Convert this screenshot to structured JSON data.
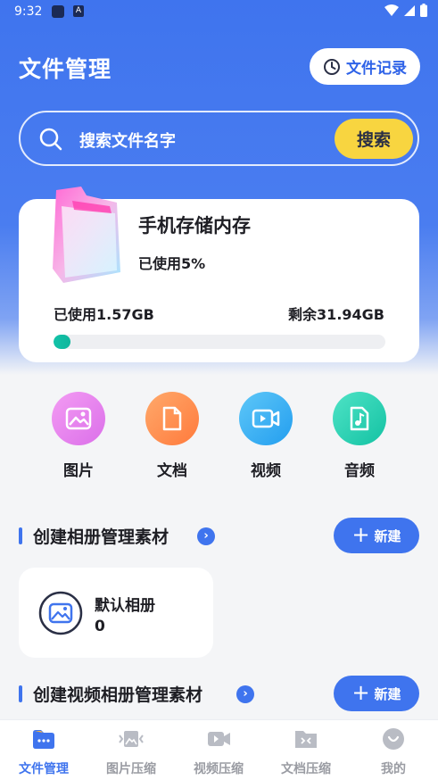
{
  "status_bar": {
    "time": "9:32"
  },
  "header": {
    "title": "文件管理",
    "record_button": "文件记录"
  },
  "search": {
    "placeholder": "搜索文件名字",
    "button": "搜索"
  },
  "storage": {
    "title": "手机存储内存",
    "used_percent_text": "已使用5%",
    "used_text": "已使用1.57GB",
    "free_text": "剩余31.94GB",
    "used_fraction": 0.05
  },
  "categories": [
    {
      "label": "图片",
      "icon": "image-icon",
      "color": "#e98bf0"
    },
    {
      "label": "文档",
      "icon": "document-icon",
      "color": "#ff8f52"
    },
    {
      "label": "视频",
      "icon": "video-icon",
      "color": "#3ab0f4"
    },
    {
      "label": "音频",
      "icon": "music-icon",
      "color": "#2ad3b7"
    }
  ],
  "sections": {
    "album": {
      "title": "创建相册管理素材",
      "new_button": "新建"
    },
    "video_album": {
      "title": "创建视频相册管理素材",
      "new_button": "新建"
    }
  },
  "album_card": {
    "name": "默认相册",
    "count": "0"
  },
  "bottom_nav": [
    {
      "label": "文件管理",
      "icon": "folder-icon",
      "active": true
    },
    {
      "label": "图片压缩",
      "icon": "image-compress-icon",
      "active": false
    },
    {
      "label": "视频压缩",
      "icon": "video-compress-icon",
      "active": false
    },
    {
      "label": "文档压缩",
      "icon": "doc-compress-icon",
      "active": false
    },
    {
      "label": "我的",
      "icon": "profile-icon",
      "active": false
    }
  ],
  "colors": {
    "primary": "#3f74ee",
    "search_button": "#f8d540",
    "progress": "#12c3a8"
  }
}
